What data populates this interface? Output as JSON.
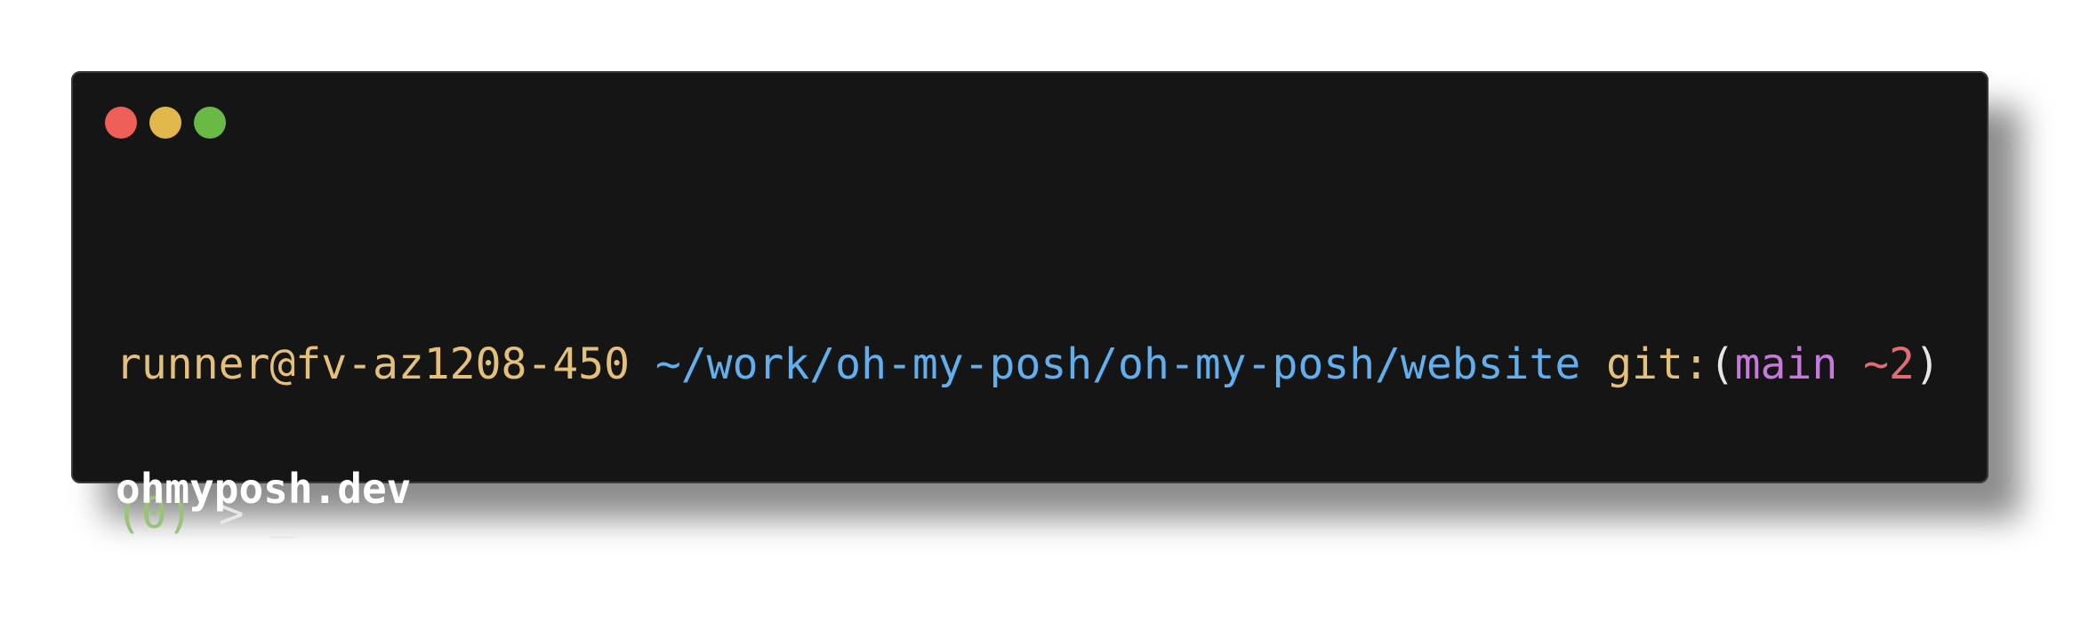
{
  "window": {
    "controls": [
      {
        "name": "close-icon",
        "color": "#ee5f58"
      },
      {
        "name": "minimize-icon",
        "color": "#e2b84b"
      },
      {
        "name": "maximize-icon",
        "color": "#6ab945"
      }
    ]
  },
  "prompt": {
    "user_host": "runner@fv-az1208-450",
    "path": "~/work/oh-my-posh/oh-my-posh/website",
    "git_label": "git:",
    "git_open": "(",
    "branch": "main",
    "changes": "~2",
    "git_close": ")",
    "exit_status": "(0)",
    "prompt_char": ">",
    "cursor": "_"
  },
  "footer": {
    "text": "ohmyposh.dev"
  },
  "colors": {
    "user_host": "#e5c07b",
    "path": "#61afef",
    "git_label": "#e5c07b",
    "branch": "#c678dd",
    "changes": "#e06c75",
    "exit_status": "#98c379",
    "default_text": "#e6e6e6"
  }
}
